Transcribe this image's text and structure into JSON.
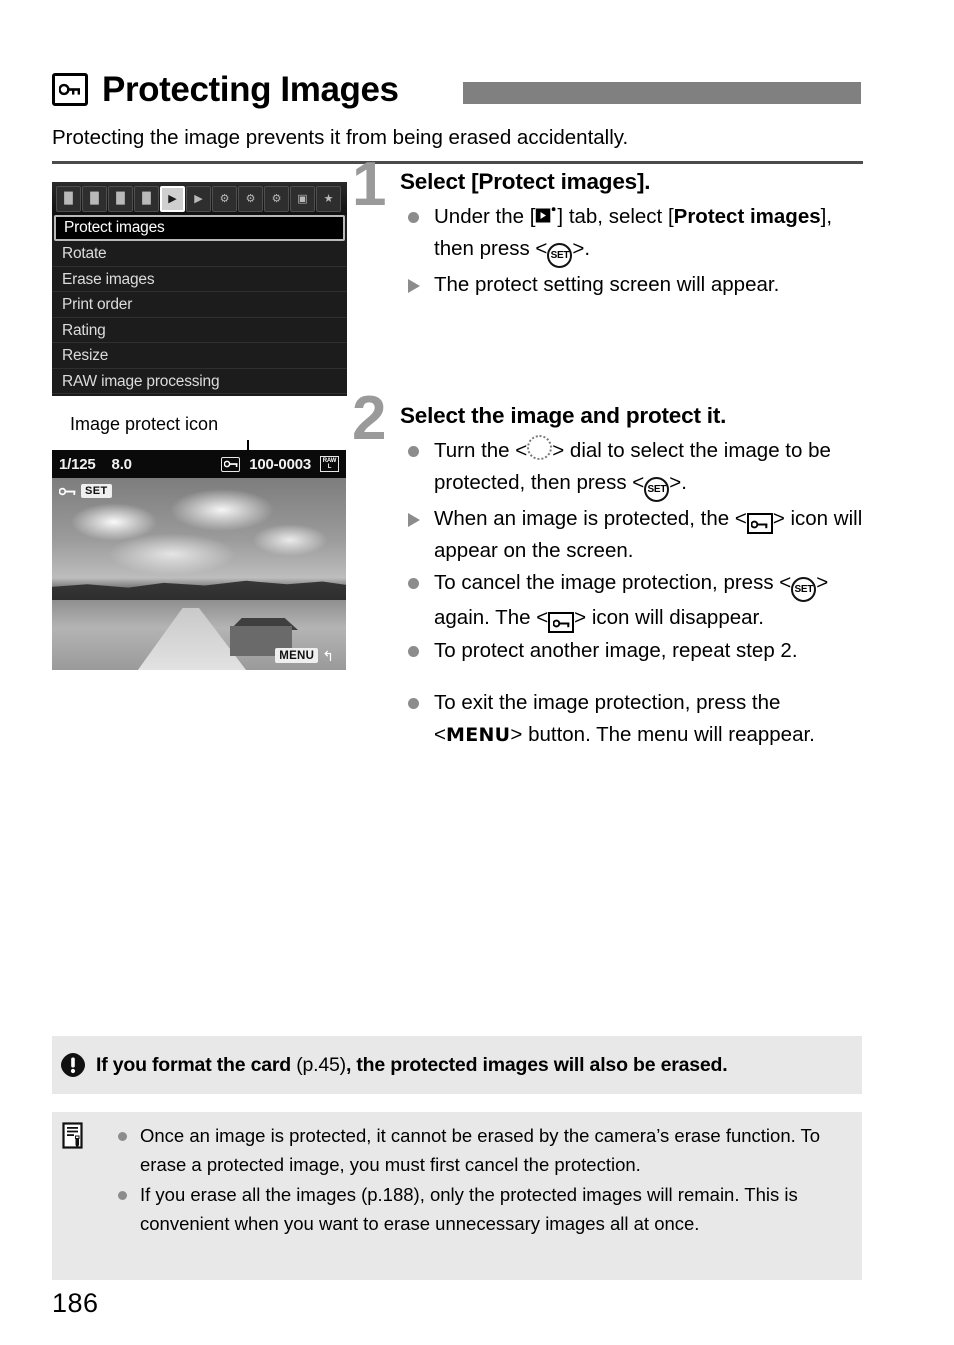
{
  "page": {
    "number": "186",
    "title": "Protecting Images",
    "title_icon": "key-in-box-icon",
    "subtitle": "Protecting the image prevents it from being erased accidentally."
  },
  "menu_screenshot": {
    "tabs": [
      {
        "name": "shooting-tab-1",
        "glyph": "█",
        "active": false
      },
      {
        "name": "shooting-tab-2",
        "glyph": "█",
        "active": false
      },
      {
        "name": "shooting-tab-3",
        "glyph": "█",
        "active": false
      },
      {
        "name": "shooting-tab-4",
        "glyph": "█",
        "active": false
      },
      {
        "name": "playback-tab-1",
        "glyph": "▶",
        "active": true
      },
      {
        "name": "playback-tab-2",
        "glyph": "▶",
        "active": false
      },
      {
        "name": "setup-tab-1",
        "glyph": "⚙",
        "active": false
      },
      {
        "name": "setup-tab-2",
        "glyph": "⚙",
        "active": false
      },
      {
        "name": "setup-tab-3",
        "glyph": "⚙",
        "active": false
      },
      {
        "name": "custom-functions-tab",
        "glyph": "▣",
        "active": false
      },
      {
        "name": "my-menu-tab",
        "glyph": "★",
        "active": false
      }
    ],
    "items": [
      {
        "label": "Protect images",
        "selected": true
      },
      {
        "label": "Rotate",
        "selected": false
      },
      {
        "label": "Erase images",
        "selected": false
      },
      {
        "label": "Print order",
        "selected": false
      },
      {
        "label": "Rating",
        "selected": false
      },
      {
        "label": "Resize",
        "selected": false
      },
      {
        "label": "RAW image processing",
        "selected": false
      }
    ]
  },
  "lcd_screenshot": {
    "caption": "Image protect icon",
    "shutter_speed": "1/125",
    "aperture": "8.0",
    "protect_icon": "key-badge-icon",
    "file_number": "100-0003",
    "quality_badge_top": "RAW",
    "quality_badge_bottom": "L",
    "set_hint_key_icon": "key-icon",
    "set_hint_label": "SET",
    "menu_hint_label": "MENU",
    "menu_hint_arrow": "↰"
  },
  "steps": [
    {
      "number": "1",
      "heading": "Select [Protect images].",
      "bullets": [
        {
          "type": "dot",
          "parts": [
            {
              "t": "text",
              "v": "Under the ["
            },
            {
              "t": "icon",
              "v": "playback-tab-icon"
            },
            {
              "t": "text",
              "v": "] tab, select ["
            },
            {
              "t": "bold",
              "v": "Protect images"
            },
            {
              "t": "text",
              "v": "], then press <"
            },
            {
              "t": "icon",
              "v": "set-button-icon"
            },
            {
              "t": "text",
              "v": ">."
            }
          ]
        },
        {
          "type": "triangle",
          "parts": [
            {
              "t": "text",
              "v": "The protect setting screen will appear."
            }
          ]
        }
      ]
    },
    {
      "number": "2",
      "heading": "Select the image and protect it.",
      "bullets": [
        {
          "type": "dot",
          "parts": [
            {
              "t": "text",
              "v": "Turn the <"
            },
            {
              "t": "icon",
              "v": "quick-control-dial-icon"
            },
            {
              "t": "text",
              "v": "> dial to select the image to be protected, then press <"
            },
            {
              "t": "icon",
              "v": "set-button-icon"
            },
            {
              "t": "text",
              "v": ">."
            }
          ]
        },
        {
          "type": "triangle",
          "parts": [
            {
              "t": "text",
              "v": "When an image is protected, the <"
            },
            {
              "t": "icon",
              "v": "key-box-icon"
            },
            {
              "t": "text",
              "v": "> icon will appear on the screen."
            }
          ]
        },
        {
          "type": "dot",
          "parts": [
            {
              "t": "text",
              "v": "To cancel the image protection, press <"
            },
            {
              "t": "icon",
              "v": "set-button-icon"
            },
            {
              "t": "text",
              "v": "> again. The <"
            },
            {
              "t": "icon",
              "v": "key-box-icon"
            },
            {
              "t": "text",
              "v": "> icon will disappear."
            }
          ]
        },
        {
          "type": "dot",
          "parts": [
            {
              "t": "text",
              "v": "To protect another image, repeat step 2."
            }
          ]
        },
        {
          "type": "dot",
          "gap": true,
          "parts": [
            {
              "t": "text",
              "v": "To exit the image protection, press the <"
            },
            {
              "t": "menu",
              "v": "MENU"
            },
            {
              "t": "text",
              "v": "> button. The menu will reappear."
            }
          ]
        }
      ]
    }
  ],
  "caution": {
    "icon": "exclamation-icon",
    "parts": [
      {
        "t": "bold",
        "v": "If you format the card "
      },
      {
        "t": "text",
        "v": "(p.45)"
      },
      {
        "t": "bold",
        "v": ", the protected images will also be erased."
      }
    ]
  },
  "note": {
    "icon": "note-pencil-icon",
    "items": [
      "Once an image is protected, it cannot be erased by the camera’s erase function. To erase a protected image, you must first cancel the protection.",
      "If you erase all the images (p.188), only the protected images will remain. This is convenient when you want to erase unnecessary images all at once."
    ]
  },
  "colors": {
    "accent_bar": "#808080",
    "step_number": "#9a9a9a",
    "bullet": "#8c8c8c",
    "box_background": "#e8e8e8",
    "rule": "#4b4b4b"
  }
}
